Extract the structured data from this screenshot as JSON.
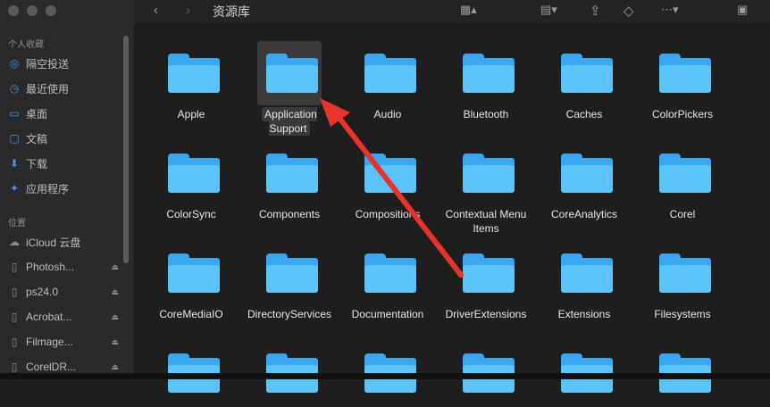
{
  "toolbar": {
    "title": "资源库",
    "back_icon": "chevron-left-icon",
    "forward_icon": "chevron-right-icon"
  },
  "sidebar": {
    "favorites_title": "个人收藏",
    "favorites": [
      {
        "label": "隔空投送",
        "icon": "airdrop-icon"
      },
      {
        "label": "最近使用",
        "icon": "clock-icon"
      },
      {
        "label": "桌面",
        "icon": "desktop-icon"
      },
      {
        "label": "文稿",
        "icon": "document-icon"
      },
      {
        "label": "下载",
        "icon": "download-icon"
      },
      {
        "label": "应用程序",
        "icon": "applications-icon"
      }
    ],
    "locations_title": "位置",
    "locations": [
      {
        "label": "iCloud 云盘",
        "icon": "cloud-icon",
        "eject": false
      },
      {
        "label": "Photosh...",
        "icon": "disk-icon",
        "eject": true
      },
      {
        "label": "ps24.0",
        "icon": "disk-icon",
        "eject": true
      },
      {
        "label": "Acrobat...",
        "icon": "disk-icon",
        "eject": true
      },
      {
        "label": "Filmage...",
        "icon": "disk-icon",
        "eject": true
      },
      {
        "label": "CorelDR...",
        "icon": "disk-icon",
        "eject": true
      }
    ]
  },
  "folders": [
    {
      "label": "Apple",
      "selected": false
    },
    {
      "label": "Application Support",
      "selected": true
    },
    {
      "label": "Audio",
      "selected": false
    },
    {
      "label": "Bluetooth",
      "selected": false
    },
    {
      "label": "Caches",
      "selected": false
    },
    {
      "label": "ColorPickers",
      "selected": false
    },
    {
      "label": "ColorSync",
      "selected": false
    },
    {
      "label": "Components",
      "selected": false
    },
    {
      "label": "Compositions",
      "selected": false
    },
    {
      "label": "Contextual Menu Items",
      "selected": false
    },
    {
      "label": "CoreAnalytics",
      "selected": false
    },
    {
      "label": "Corel",
      "selected": false
    },
    {
      "label": "CoreMediaIO",
      "selected": false
    },
    {
      "label": "DirectoryServices",
      "selected": false
    },
    {
      "label": "Documentation",
      "selected": false
    },
    {
      "label": "DriverExtensions",
      "selected": false
    },
    {
      "label": "Extensions",
      "selected": false
    },
    {
      "label": "Filesystems",
      "selected": false
    },
    {
      "label": "",
      "selected": false
    },
    {
      "label": "",
      "selected": false
    },
    {
      "label": "",
      "selected": false
    },
    {
      "label": "",
      "selected": false
    },
    {
      "label": "",
      "selected": false
    },
    {
      "label": "",
      "selected": false
    }
  ],
  "colors": {
    "arrow": "#e8322c",
    "folder": "#5cc3fb",
    "accent": "#4a8fe0"
  }
}
